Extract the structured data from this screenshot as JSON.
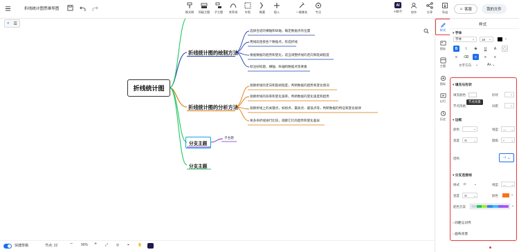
{
  "window": {
    "title": "折线统计图思维导图"
  },
  "toolbar": {
    "items": [
      "格式刷",
      "同级主题",
      "子主题",
      "关系线",
      "外框",
      "概要",
      "插入",
      "一键美化",
      "专注"
    ],
    "ai_label": "AI助手",
    "collab_label": "协作",
    "share_label": "分享",
    "export_label": "导出",
    "save_label": "客服",
    "myfiles_label": "我的文件"
  },
  "accent": "#1f6feb",
  "mindmap": {
    "root": "折线统计图",
    "topics": [
      {
        "label": "折线统计图的绘制方法",
        "color": "#1e40af",
        "children": [
          "选择合适的横轴和纵轴，确定数据点的位置",
          "用线段连接各个数据点，形成折线",
          "根据数据的趋势和变化，适当调整折线的走向和陡峭程度",
          "标注好标题、横轴、纵轴和数据点等要素"
        ]
      },
      {
        "label": "折线统计图的分析方法",
        "color": "#d97706",
        "children": [
          "观察折线的走向和陡峭程度，判断数据的趋势和变化情况",
          "观察折线的斜率和变化速率，判断数据的变化速度和趋势",
          "观察折线上的关键点，如拐点、最高点、最低点等，判断数据的特征和变化规律",
          "将多条折线进行比较，观察它们的趋势和变化差异"
        ]
      },
      {
        "label": "分支主题",
        "color": "#7e22ce",
        "children": [
          "子主题"
        ]
      },
      {
        "label": "分支主题",
        "color": "#22c55e",
        "children": []
      }
    ]
  },
  "sidebar": {
    "items": [
      "样式",
      "图标",
      "主题",
      "图标",
      "幻灯",
      "历史"
    ]
  },
  "panel": {
    "title": "样式",
    "font": {
      "section": "字体",
      "family": "字体",
      "size": "18",
      "color": "#000000",
      "direction_label": "文字方向"
    },
    "shape": {
      "section": "填充与形状",
      "fill_label": "填充颜色",
      "shape_label": "形状",
      "tooltip": "节点背景",
      "style_label": "节点风格",
      "spacing_label": "间距"
    },
    "border": {
      "section": "边框",
      "color_label": "颜色",
      "linetype_label": "线型",
      "width_label": "宽度",
      "radius_label": "圆角"
    },
    "structure": {
      "section": "结构"
    },
    "branch": {
      "section": "分支连接线",
      "style_label": "样式",
      "linetype_label": "线型",
      "width_label": "宽度",
      "color_label": "颜色",
      "color": "#f97316",
      "scheme_label": "配色方案",
      "scheme_colors": [
        "#cbd5e1",
        "#22c55e",
        "#a3e635",
        "#3b82f6",
        "#38bdf8",
        "#8b5cf6",
        "#a855f7"
      ]
    },
    "align": {
      "section": "间距与对齐"
    },
    "canvas": {
      "section": "画布背景"
    }
  },
  "statusbar": {
    "shortcut_label": "快捷草稿",
    "nodes_label": "节点: 22",
    "zoom": "90%"
  }
}
